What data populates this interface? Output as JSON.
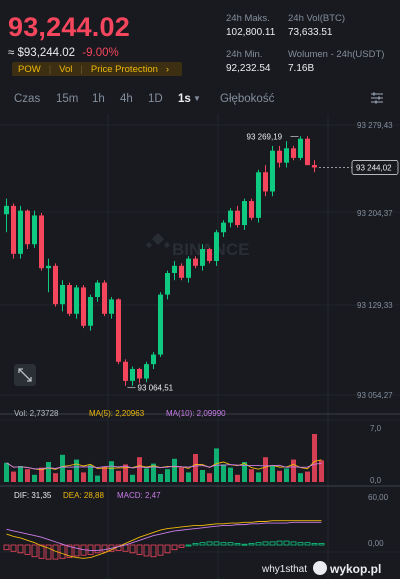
{
  "header": {
    "price": "93,244.02",
    "approx_price": "≈ $93,244.02",
    "change": "-9.00%",
    "tags": [
      "POW",
      "Vol",
      "Price Protection"
    ],
    "tags_arrow": "›"
  },
  "stats": {
    "high_label": "24h Maks.",
    "high_value": "102,800.11",
    "low_label": "24h Min.",
    "low_value": "92,232.54",
    "vol_btc_label": "24h Vol(BTC)",
    "vol_btc_value": "73,633.51",
    "vol_usdt_label": "Wolumen - 24h(USDT)",
    "vol_usdt_value": "7.16B"
  },
  "toolbar": {
    "items": [
      "Czas",
      "15m",
      "1h",
      "4h",
      "1D",
      "1s",
      "Głębokość"
    ],
    "active": "1s",
    "dropdown_icon": "triangle-down-icon",
    "settings_icon": "chart-settings-icon"
  },
  "price_axis": {
    "ticks": [
      "93 279,43",
      "93 204,37",
      "93 129,33",
      "93 054,27"
    ],
    "current_tag": "93 244,02",
    "max_label": "93 269,19",
    "min_label": "93 064,51"
  },
  "watermark": "BINANCE",
  "volume": {
    "legend_vol": "Vol: 2,73728",
    "legend_ma5": "MA(5): 2,20963",
    "legend_ma10": "MA(10): 2,09990",
    "axis_top": "7,0",
    "axis_bottom": "0,0"
  },
  "macd": {
    "legend_dif": "DIF: 31,35",
    "legend_dea": "DEA: 28,88",
    "legend_macd": "MACD: 2,47",
    "axis_top": "60,00",
    "axis_bottom": "0,00"
  },
  "colors": {
    "up": "#0ecb81",
    "down": "#f6465d",
    "ma5": "#f0b90b",
    "ma10": "#c97de8",
    "background": "#181a20"
  },
  "footer": {
    "watermark_user": "why1sthat",
    "watermark_site": "wykop.pl"
  },
  "chart_data": {
    "type": "candlestick",
    "ylim": [
      93040,
      93285
    ],
    "candles": [
      [
        93205,
        93218,
        93190,
        93212
      ],
      [
        93212,
        93214,
        93168,
        93172
      ],
      [
        93172,
        93212,
        93168,
        93208
      ],
      [
        93208,
        93209,
        93176,
        93180
      ],
      [
        93180,
        93208,
        93177,
        93204
      ],
      [
        93204,
        93206,
        93158,
        93160
      ],
      [
        93160,
        93168,
        93140,
        93162
      ],
      [
        93162,
        93164,
        93128,
        93130
      ],
      [
        93130,
        93150,
        93124,
        93146
      ],
      [
        93146,
        93148,
        93120,
        93122
      ],
      [
        93122,
        93146,
        93118,
        93144
      ],
      [
        93144,
        93146,
        93110,
        93112
      ],
      [
        93112,
        93138,
        93108,
        93136
      ],
      [
        93136,
        93150,
        93132,
        93148
      ],
      [
        93148,
        93150,
        93120,
        93122
      ],
      [
        93122,
        93136,
        93118,
        93134
      ],
      [
        93134,
        93135,
        93080,
        93082
      ],
      [
        93082,
        93084,
        93062,
        93066
      ],
      [
        93066,
        93078,
        93062,
        93076
      ],
      [
        93076,
        93077,
        93064,
        93068
      ],
      [
        93068,
        93082,
        93065,
        93080
      ],
      [
        93080,
        93090,
        93076,
        93088
      ],
      [
        93088,
        93140,
        93086,
        93138
      ],
      [
        93138,
        93158,
        93134,
        93156
      ],
      [
        93156,
        93166,
        93150,
        93162
      ],
      [
        93162,
        93164,
        93150,
        93152
      ],
      [
        93152,
        93170,
        93148,
        93168
      ],
      [
        93168,
        93170,
        93160,
        93162
      ],
      [
        93162,
        93180,
        93158,
        93176
      ],
      [
        93176,
        93177,
        93164,
        93166
      ],
      [
        93166,
        93192,
        93162,
        93190
      ],
      [
        93190,
        93200,
        93186,
        93198
      ],
      [
        93198,
        93210,
        93194,
        93208
      ],
      [
        93208,
        93212,
        93194,
        93196
      ],
      [
        93196,
        93218,
        93192,
        93216
      ],
      [
        93216,
        93218,
        93200,
        93202
      ],
      [
        93202,
        93242,
        93198,
        93240
      ],
      [
        93240,
        93246,
        93220,
        93224
      ],
      [
        93224,
        93262,
        93220,
        93258
      ],
      [
        93258,
        93262,
        93244,
        93248
      ],
      [
        93248,
        93266,
        93244,
        93260
      ],
      [
        93260,
        93262,
        93250,
        93252
      ],
      [
        93252,
        93270,
        93250,
        93268
      ],
      [
        93268,
        93270,
        93246,
        93246
      ],
      [
        93246,
        93250,
        93240,
        93244
      ]
    ],
    "volumes": [
      2.4,
      1.3,
      2.0,
      1.6,
      0.9,
      1.8,
      2.5,
      1.1,
      3.4,
      1.5,
      2.8,
      1.2,
      2.1,
      0.8,
      1.9,
      2.6,
      1.4,
      2.2,
      0.9,
      3.1,
      1.7,
      2.3,
      1.0,
      1.6,
      2.9,
      1.8,
      1.2,
      3.5,
      1.5,
      1.1,
      4.2,
      2.2,
      1.8,
      0.9,
      2.5,
      1.6,
      1.2,
      3.1,
      2.0,
      1.4,
      1.7,
      2.8,
      1.1,
      1.3,
      6.0,
      2.7
    ],
    "macd_hist": [
      -6,
      -8,
      -10,
      -12,
      -15,
      -17,
      -18,
      -18,
      -17,
      -16,
      -14,
      -13,
      -12,
      -10,
      -9,
      -8,
      -7,
      -8,
      -10,
      -12,
      -14,
      -15,
      -13,
      -10,
      -6,
      -3,
      0,
      2,
      3,
      4,
      4,
      3,
      3,
      2,
      1,
      2,
      3,
      4,
      4,
      5,
      5,
      4,
      3,
      3,
      2,
      2
    ],
    "dif": [
      14,
      11,
      9,
      6,
      3,
      -1,
      -4,
      -8,
      -11,
      -14,
      -16,
      -17,
      -16,
      -13,
      -10,
      -6,
      -2,
      2,
      6,
      10,
      13,
      16,
      19,
      21,
      22,
      23,
      24,
      25,
      25,
      26,
      27,
      27,
      28,
      28,
      29,
      29,
      30,
      30,
      31,
      31,
      31,
      31,
      31,
      31,
      31,
      31
    ],
    "dea": [
      20,
      18,
      16,
      14,
      12,
      10,
      7,
      4,
      1,
      -2,
      -4,
      -6,
      -7,
      -7,
      -6,
      -4,
      -2,
      0,
      3,
      6,
      9,
      12,
      14,
      16,
      18,
      19,
      20,
      21,
      22,
      23,
      24,
      25,
      25,
      26,
      26,
      27,
      27,
      28,
      28,
      28,
      28,
      29,
      29,
      29,
      29,
      29
    ]
  }
}
